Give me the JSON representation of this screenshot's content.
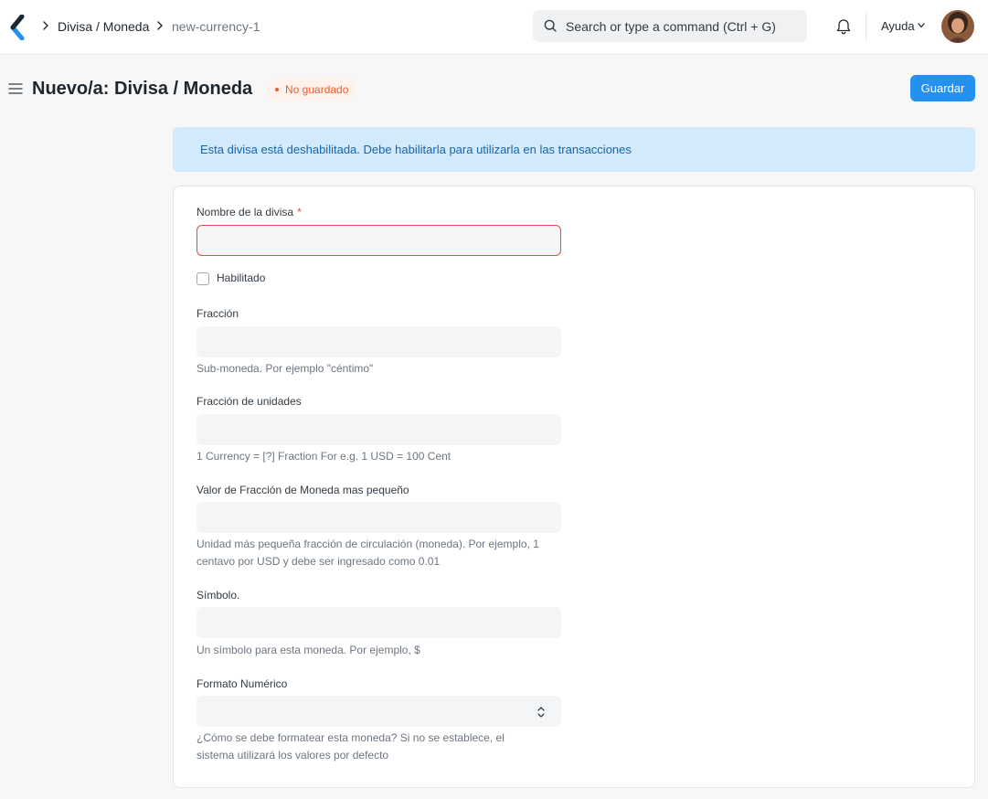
{
  "navbar": {
    "breadcrumbs": [
      {
        "label": "Divisa / Moneda"
      },
      {
        "label": "new-currency-1"
      }
    ],
    "search_placeholder": "Search or type a command (Ctrl + G)",
    "help_label": "Ayuda",
    "icons": [
      "app-logo-icon",
      "chevron-right-icon",
      "search-icon",
      "bell-icon",
      "chevron-down-icon",
      "avatar"
    ]
  },
  "page": {
    "title": "Nuevo/a: Divisa / Moneda",
    "status": "No guardado",
    "save_label": "Guardar",
    "menu_icon": "hamburger-icon"
  },
  "alert": {
    "message": "Esta divisa está deshabilitada. Debe habilitarla para utilizarla en las transacciones"
  },
  "form": {
    "currency_name": {
      "label": "Nombre de la divisa",
      "required_mark": "*",
      "value": ""
    },
    "enabled": {
      "label": "Habilitado",
      "checked": false
    },
    "fraction": {
      "label": "Fracción",
      "value": "",
      "help": "Sub-moneda. Por ejemplo \"céntimo\""
    },
    "fraction_units": {
      "label": "Fracción de unidades",
      "value": "",
      "help": "1 Currency = [?] Fraction For e.g. 1 USD = 100 Cent"
    },
    "smallest_fraction": {
      "label": "Valor de Fracción de Moneda mas pequeño",
      "value": "",
      "help": "Unidad más pequeña fracción de circulación (moneda). Por ejemplo, 1 centavo por USD y debe ser ingresado como 0.01"
    },
    "symbol": {
      "label": "Símbolo.",
      "value": "",
      "help": "Un símbolo para esta moneda. Por ejemplo, $"
    },
    "number_format": {
      "label": "Formato Numérico",
      "value": "",
      "help": "¿Cómo se debe formatear esta moneda? Si no se establece, el sistema utilizará los valores por defecto"
    }
  },
  "colors": {
    "primary": "#2490ef",
    "alert_bg": "#d3e9fc",
    "alert_text": "#1366ae",
    "status_text": "#e55d30",
    "error_border": "#e24c4c"
  }
}
